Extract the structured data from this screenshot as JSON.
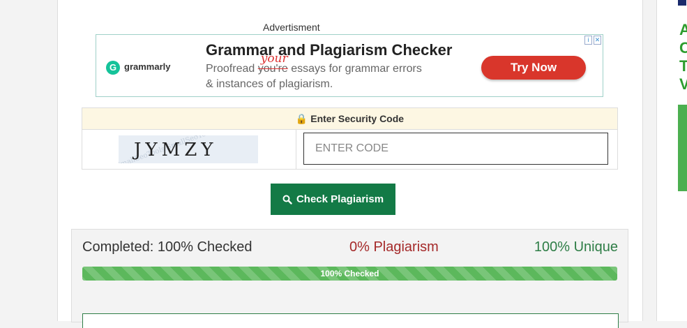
{
  "advert": {
    "label": "Advertisment",
    "brand": "grammarly",
    "brand_icon": "G",
    "title": "Grammar and Plagiarism Checker",
    "line1_before": "Proofread ",
    "line1_struck": "you're",
    "line1_correction": "your",
    "line1_after": " essays for grammar errors",
    "line2": "& instances of plagiarism.",
    "cta": "Try Now",
    "cta_color": "#d9362b"
  },
  "security": {
    "heading": "Enter Security Code",
    "captcha_text": "JYMZY",
    "captcha_watermark": "SmallSeoTools SmallSeoTools SmallSeoTools",
    "input_placeholder": "ENTER CODE"
  },
  "check_button": {
    "label": "Check Plagiarism",
    "color": "#137a46"
  },
  "results": {
    "completed": "Completed: 100% Checked",
    "plagiarism": "0% Plagiarism",
    "unique": "100% Unique",
    "progress_label": "100% Checked",
    "progress_percent": 100
  },
  "right_panel": {
    "letters": "A\nC\nT\nV"
  }
}
